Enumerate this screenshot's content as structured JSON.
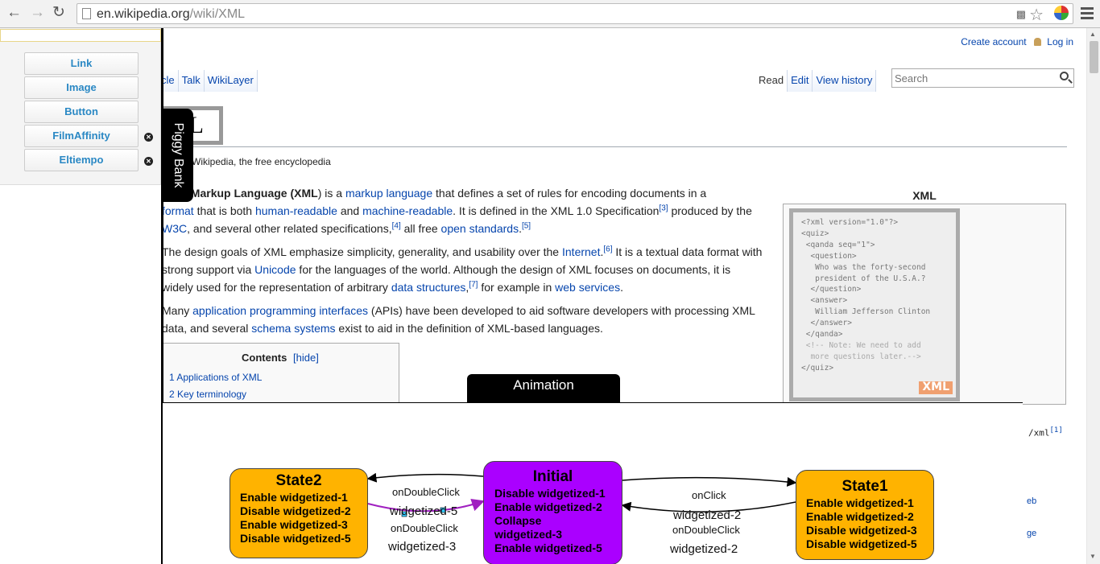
{
  "browser": {
    "url_host": "en.wikipedia.org",
    "url_path": "/wiki/XML",
    "back_icon": "back-arrow-icon",
    "forward_icon": "forward-arrow-icon",
    "reload_icon": "reload-icon"
  },
  "wiki": {
    "personal": {
      "create_account": "Create account",
      "login": "Log in"
    },
    "left_tabs": [
      "cle",
      "Talk",
      "WikiLayer"
    ],
    "right_tabs": [
      "Read",
      "Edit",
      "View history"
    ],
    "search_placeholder": "Search",
    "logo_text": "ML",
    "site_sub": "Wikipedia, the free encyclopedia",
    "p1": {
      "t1": "sible Markup Language (",
      "b1": "XML",
      "t2": ") is a ",
      "l1": "markup language",
      "t3": " that defines a set of rules for encoding documents in a",
      "l2": "format",
      "t4": " that is both ",
      "l3": "human-readable",
      "t5": " and ",
      "l4": "machine-readable",
      "t6": ". It is defined in the XML 1.0 Specification",
      "s1": "[3]",
      "t7": " produced by the",
      "l5": "W3C",
      "t8": ", and several other related specifications,",
      "s2": "[4]",
      "t9": " all free ",
      "l6": "open standards",
      "t10": ".",
      "s3": "[5]"
    },
    "p2": {
      "t1": "The design goals of XML emphasize simplicity, generality, and usability over the ",
      "l1": "Internet",
      "t2": ".",
      "s1": "[6]",
      "t3": " It is a textual data format with",
      "t4": "strong support via ",
      "l2": "Unicode",
      "t5": " for the languages of the world. Although the design of XML focuses on documents, it is",
      "t6": "widely used for the representation of arbitrary ",
      "l3": "data structures",
      "t7": ",",
      "s2": "[7]",
      "t8": " for example in ",
      "l4": "web services",
      "t9": "."
    },
    "p3": {
      "t1": "Many ",
      "l1": "application programming interfaces",
      "t2": " (APIs) have been developed to aid software developers with processing XML",
      "t3": "data, and several ",
      "l2": "schema systems",
      "t4": " exist to aid in the definition of XML-based languages."
    },
    "toc": {
      "title": "Contents",
      "hide": "[hide]",
      "items": [
        "1 Applications of XML",
        "2 Key terminology"
      ]
    },
    "infobox": {
      "caption": "XML",
      "code_lines": [
        "<?xml version=\"1.0\"?>",
        "<quiz>",
        " <qanda seq=\"1\">",
        "  <question>",
        "   Who was the forty-second",
        "   president of the U.S.A.?",
        "  </question>",
        "  <answer>",
        "   William Jefferson Clinton",
        "  </answer>",
        " </qanda>",
        " <!-- Note: We need to add",
        "  more questions later.-->",
        "</quiz>"
      ],
      "badge": "XML"
    },
    "right_fragments": {
      "xml_text": "/xml",
      "xml_sup": "[1]",
      "eb": "eb",
      "ge": "ge"
    }
  },
  "piggy_panel": {
    "buttons": [
      "Link",
      "Image",
      "Button",
      "FilmAffinity",
      "Eltiempo"
    ],
    "closable": [
      false,
      false,
      false,
      true,
      true
    ],
    "close_icon": "close-circle-icon",
    "tab_label": "Piggy Bank"
  },
  "animation": {
    "tab_label": "Animation",
    "states": {
      "state2": {
        "name": "State2",
        "lines": [
          "Enable widgetized-1",
          "Disable widgetized-2",
          "Enable widgetized-3",
          "Disable widgetized-5"
        ],
        "color": "#ffb300"
      },
      "initial": {
        "name": "Initial",
        "lines": [
          "Disable widgetized-1",
          "Enable widgetized-2",
          "Collapse",
          "widgetized-3",
          "Enable widgetized-5"
        ],
        "color": "#aa00ff"
      },
      "state1": {
        "name": "State1",
        "lines": [
          "Enable widgetized-1",
          "Enable widgetized-2",
          "Disable widgetized-3",
          "Disable widgetized-5"
        ],
        "color": "#ffb300"
      }
    },
    "edges": {
      "i_to_s2": {
        "event": "onDoubleClick",
        "widget": "widgetized-5"
      },
      "s2_to_i": {
        "event": "onDoubleClick",
        "widget": "widgetized-3"
      },
      "i_to_s1": {
        "event": "onClick",
        "widget": "widgetized-2"
      },
      "s1_to_i": {
        "event": "onDoubleClick",
        "widget": "widgetized-2"
      }
    }
  }
}
